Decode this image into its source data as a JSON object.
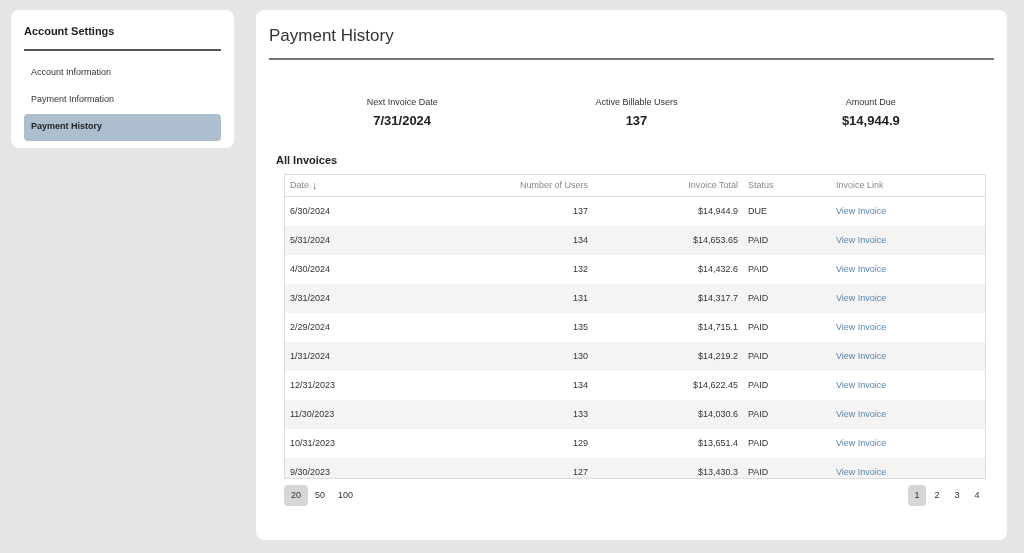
{
  "sidebar": {
    "title": "Account Settings",
    "items": [
      {
        "label": "Account Information",
        "selected": false
      },
      {
        "label": "Payment Information",
        "selected": false
      },
      {
        "label": "Payment History",
        "selected": true
      }
    ]
  },
  "main": {
    "title": "Payment History",
    "summary": [
      {
        "label": "Next Invoice Date",
        "value": "7/31/2024"
      },
      {
        "label": "Active Billable Users",
        "value": "137"
      },
      {
        "label": "Amount Due",
        "value": "$14,944.9"
      }
    ],
    "table_title": "All Invoices",
    "table": {
      "columns": [
        {
          "label": "Date",
          "sort_icon": "↓"
        },
        {
          "label": "Number of Users"
        },
        {
          "label": "Invoice Total"
        },
        {
          "label": "Status"
        },
        {
          "label": "Invoice Link"
        }
      ],
      "rows": [
        [
          "6/30/2024",
          "137",
          "$14,944.9",
          "DUE",
          "View Invoice"
        ],
        [
          "5/31/2024",
          "134",
          "$14,653.65",
          "PAID",
          "View Invoice"
        ],
        [
          "4/30/2024",
          "132",
          "$14,432.6",
          "PAID",
          "View Invoice"
        ],
        [
          "3/31/2024",
          "131",
          "$14,317.7",
          "PAID",
          "View Invoice"
        ],
        [
          "2/29/2024",
          "135",
          "$14,715.1",
          "PAID",
          "View Invoice"
        ],
        [
          "1/31/2024",
          "130",
          "$14,219.2",
          "PAID",
          "View Invoice"
        ],
        [
          "12/31/2023",
          "134",
          "$14,622.45",
          "PAID",
          "View Invoice"
        ],
        [
          "11/30/2023",
          "133",
          "$14,030.6",
          "PAID",
          "View Invoice"
        ],
        [
          "10/31/2023",
          "129",
          "$13,651.4",
          "PAID",
          "View Invoice"
        ],
        [
          "9/30/2023",
          "127",
          "$13,430.3",
          "PAID",
          "View Invoice"
        ]
      ]
    },
    "page_sizes": [
      {
        "label": "20",
        "selected": true
      },
      {
        "label": "50",
        "selected": false
      },
      {
        "label": "100",
        "selected": false
      }
    ],
    "pages": [
      {
        "label": "1",
        "selected": true
      },
      {
        "label": "2",
        "selected": false
      },
      {
        "label": "3",
        "selected": false
      },
      {
        "label": "4",
        "selected": false
      }
    ]
  }
}
